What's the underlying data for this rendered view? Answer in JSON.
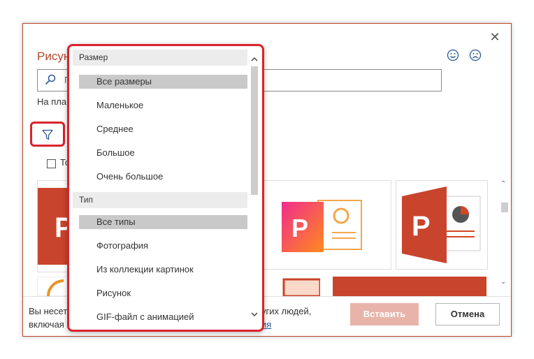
{
  "dialog": {
    "title": "Рисун",
    "close_glyph": "✕",
    "search_placeholder": "П",
    "subtitle": "На пла",
    "checkbox_label": "То",
    "footer_line1": "Вы несет",
    "footer_line2": "включая",
    "footer_right_line1": "угих людей,",
    "footer_right_link": "ия",
    "insert_label": "Вставить",
    "cancel_label": "Отмена"
  },
  "dropdown": {
    "size_header": "Размер",
    "size_items": [
      "Все размеры",
      "Маленькое",
      "Среднее",
      "Большое",
      "Очень большое"
    ],
    "type_header": "Тип",
    "type_items": [
      "Все типы",
      "Фотография",
      "Из коллекции картинок",
      "Рисунок",
      "GIF-файл с анимацией"
    ]
  },
  "colors": {
    "accent": "#b7472a",
    "highlight": "#d9232d",
    "selected": "#c9c9c9"
  },
  "icons": [
    "close-icon",
    "smile-icon",
    "frown-icon",
    "search-icon",
    "filter-icon",
    "chevron-up-icon",
    "chevron-down-icon"
  ]
}
